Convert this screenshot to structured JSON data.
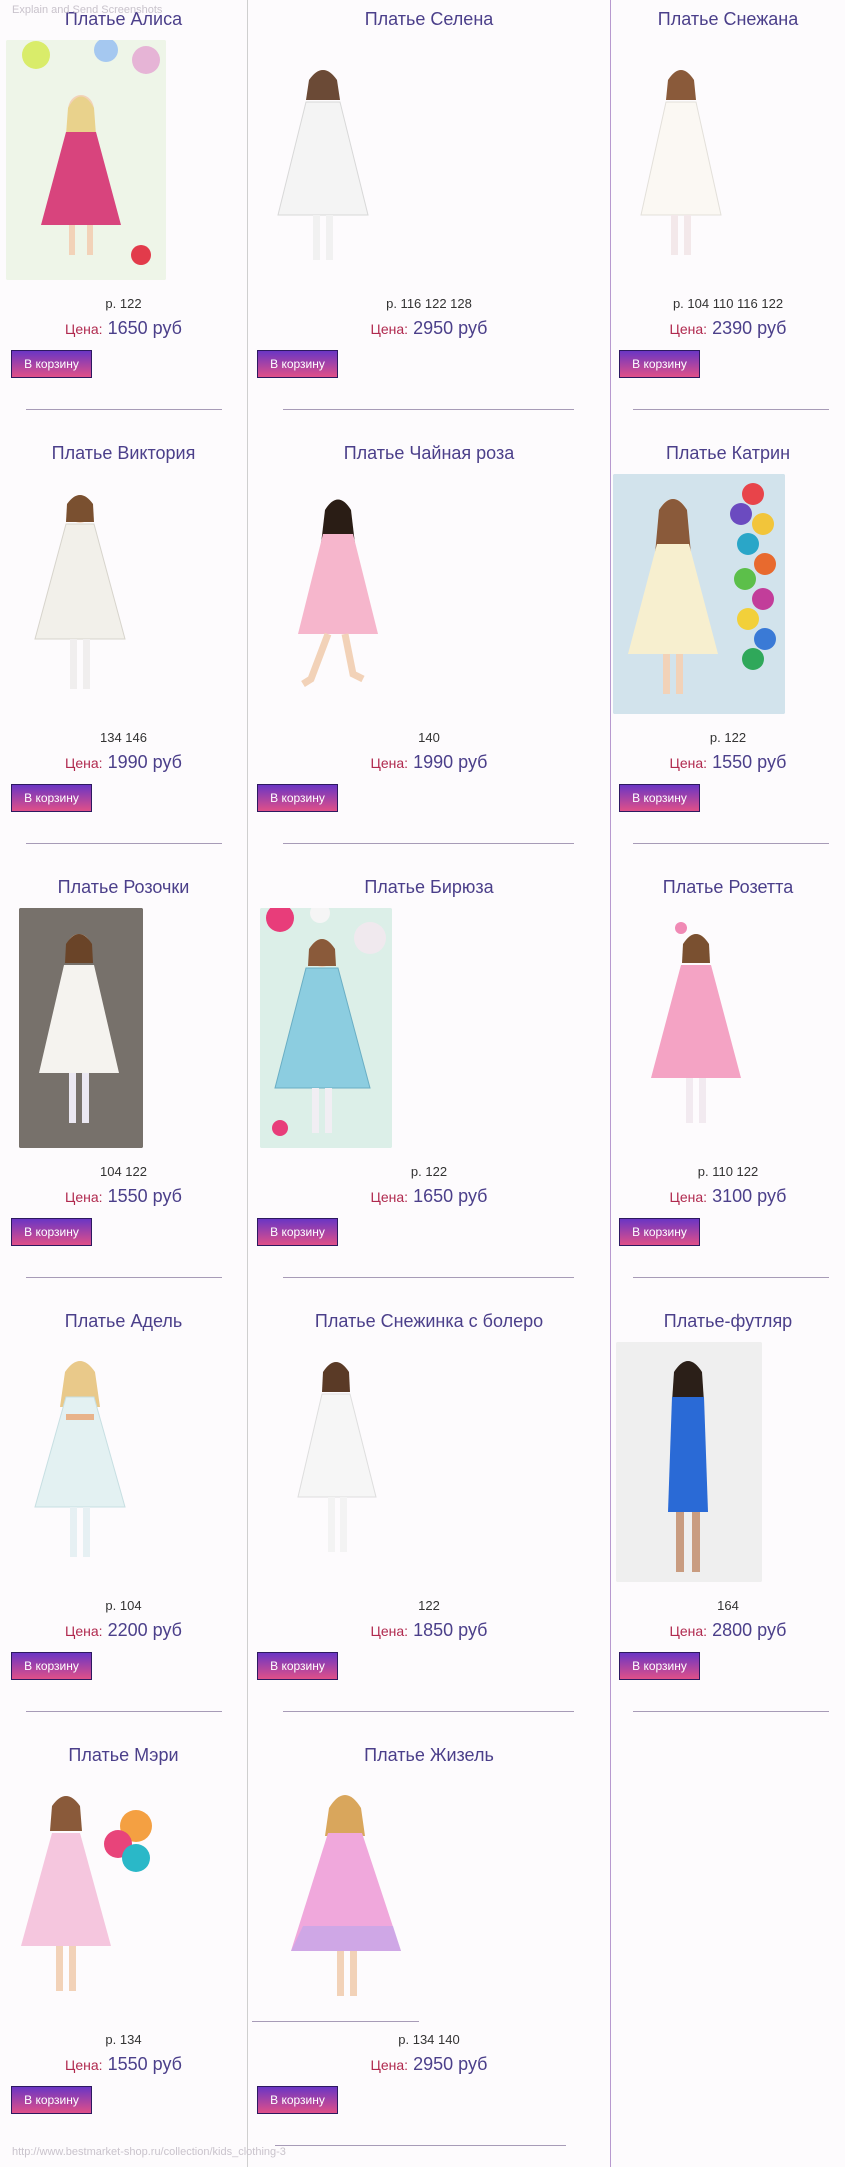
{
  "overlay": {
    "top_text": "Explain and Send Screenshots",
    "bottom_text": "http://www.bestmarket-shop.ru/collection/kids_clothing-3"
  },
  "labels": {
    "price_label": "Цена:",
    "cart_button": "В корзину"
  },
  "products": [
    {
      "name": "Платье Алиса",
      "sizes": "р. 122",
      "price": "1650 руб"
    },
    {
      "name": "Платье Селена",
      "sizes": "р. 116 122 128",
      "price": "2950 руб"
    },
    {
      "name": "Платье Снежана",
      "sizes": "р. 104 110 116 122",
      "price": "2390 руб"
    },
    {
      "name": "Платье Виктория",
      "sizes": "134 146",
      "price": "1990 руб"
    },
    {
      "name": "Платье Чайная роза",
      "sizes": "140",
      "price": "1990 руб"
    },
    {
      "name": "Платье Катрин",
      "sizes": "р. 122",
      "price": "1550 руб"
    },
    {
      "name": "Платье Розочки",
      "sizes": "104 122",
      "price": "1550 руб"
    },
    {
      "name": "Платье Бирюза",
      "sizes": "р. 122",
      "price": "1650 руб"
    },
    {
      "name": "Платье Розетта",
      "sizes": "р. 110 122",
      "price": "3100 руб"
    },
    {
      "name": "Платье Адель",
      "sizes": "р. 104",
      "price": "2200 руб"
    },
    {
      "name": "Платье Снежинка с болеро",
      "sizes": "122",
      "price": "1850 руб"
    },
    {
      "name": "Платье-футляр",
      "sizes": "164",
      "price": "2800 руб"
    },
    {
      "name": "Платье Мэри",
      "sizes": "р. 134",
      "price": "1550 руб"
    },
    {
      "name": "Платье Жизель",
      "sizes": "р. 134 140",
      "price": "2950 руб"
    }
  ]
}
